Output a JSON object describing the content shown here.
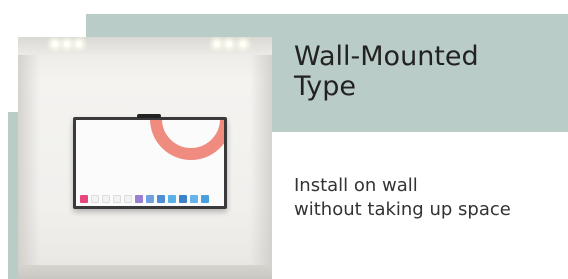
{
  "heading": {
    "line1": "Wall-Mounted",
    "line2": "Type"
  },
  "description": {
    "line1": "Install on wall",
    "line2": "without taking up space"
  },
  "colors": {
    "accent_band": "#b9ccc7",
    "screen_arc": "#f08b80"
  },
  "image": {
    "subject": "wall-mounted-display-photo"
  }
}
